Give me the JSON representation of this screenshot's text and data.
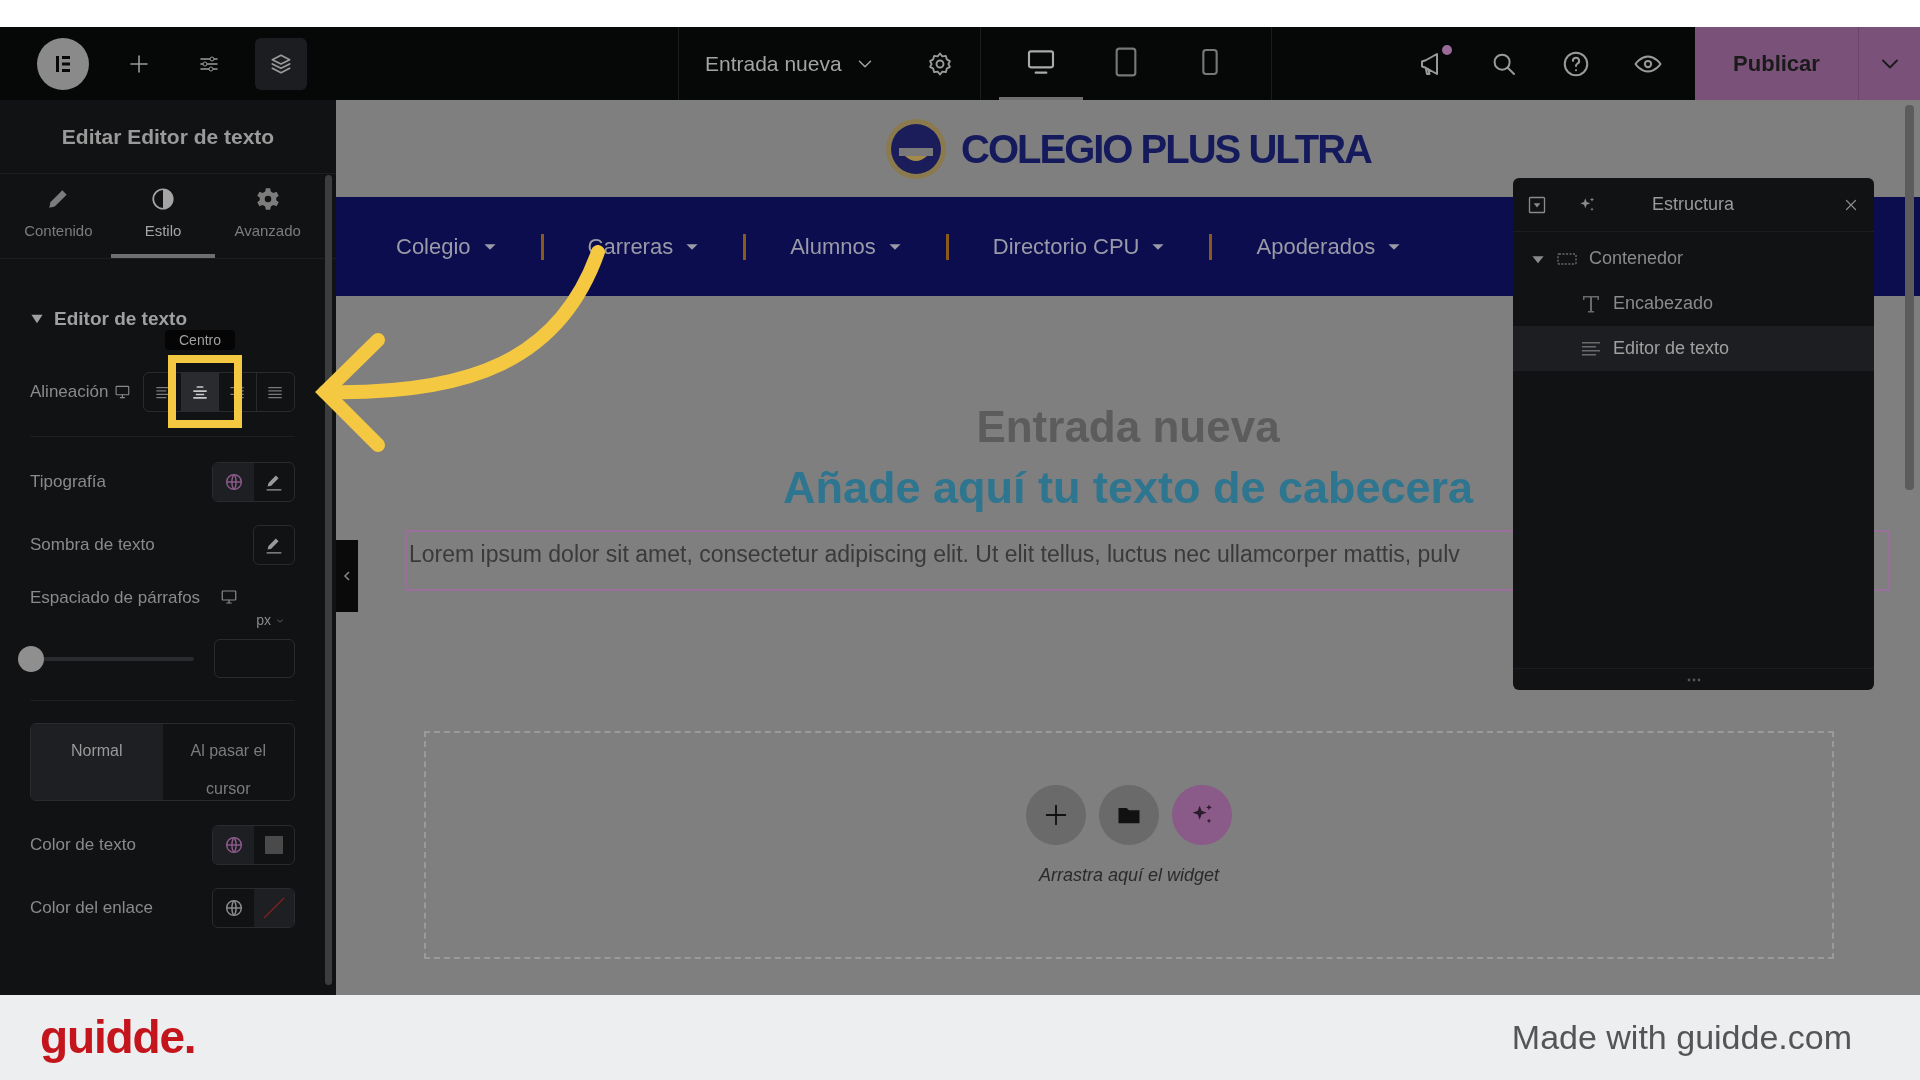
{
  "topbar": {
    "document_title": "Entrada nueva",
    "devices": [
      {
        "kind": "desktop",
        "selected": true
      },
      {
        "kind": "tablet",
        "selected": false
      },
      {
        "kind": "mobile",
        "selected": false
      }
    ],
    "notification": true,
    "publish_button": "Publicar"
  },
  "panel": {
    "title": "Editar Editor de texto",
    "tabs": [
      {
        "kind": "pencil",
        "label": "Contenido",
        "selected": false
      },
      {
        "kind": "contrast",
        "label": "Estilo",
        "selected": true
      },
      {
        "kind": "gear",
        "label": "Avanzado",
        "selected": false
      }
    ],
    "section": {
      "label": "Editor de texto",
      "expanded": true
    },
    "tooltip": "Centro",
    "alignment": {
      "label": "Alineación",
      "options": [
        {
          "kind": "left",
          "selected": false
        },
        {
          "kind": "center",
          "selected": true
        },
        {
          "kind": "right",
          "selected": false
        },
        {
          "kind": "justify",
          "selected": false
        }
      ]
    },
    "typography_label": "Tipografía",
    "text_shadow_label": "Sombra de texto",
    "spacing": {
      "label": "Espaciado de párrafos",
      "unit": "px",
      "level": 0
    },
    "state_tabs": [
      {
        "label": "Normal",
        "selected": true
      },
      {
        "label": "Al pasar el cursor",
        "selected": false
      }
    ],
    "text_color_label": "Color de texto",
    "link_color_label": "Color del enlace"
  },
  "canvas": {
    "site_title": "COLEGIO PLUS ULTRA",
    "nav": [
      "Colegio",
      "Carreras",
      "Alumnos",
      "Directorio CPU",
      "Apoderados"
    ],
    "page_title": "Entrada nueva",
    "heading": "Añade aquí tu texto de cabecera",
    "paragraph": "Lorem ipsum dolor sit amet, consectetur adipiscing elit. Ut elit tellus, luctus nec ullamcorper mattis, pulv",
    "drop_hint": "Arrastra aquí el widget"
  },
  "structure": {
    "title": "Estructura",
    "items": [
      {
        "kind": "container",
        "label": "Contenedor",
        "expanded": true,
        "selected": false,
        "children": [
          {
            "kind": "heading",
            "label": "Encabezado",
            "selected": false
          },
          {
            "kind": "text",
            "label": "Editor de texto",
            "selected": true
          }
        ]
      }
    ]
  },
  "footer": {
    "brand": "guidde.",
    "credit": "Made with guidde.com"
  }
}
